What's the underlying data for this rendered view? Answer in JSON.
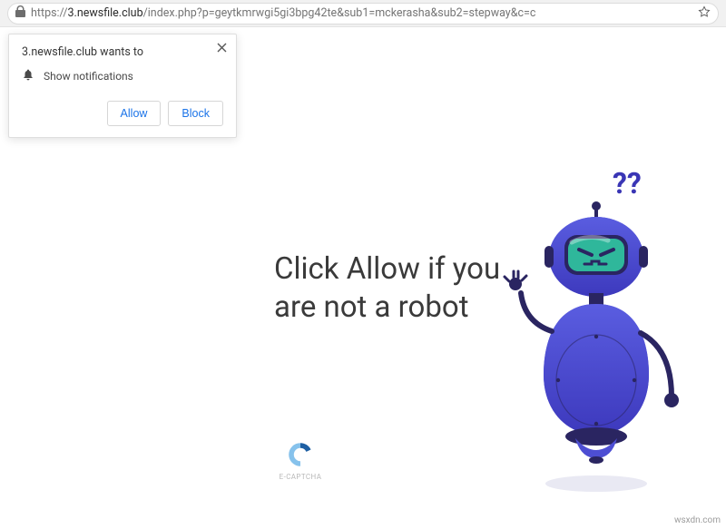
{
  "address_bar": {
    "scheme": "https://",
    "host": "3.newsfile.club",
    "path": "/index.php?p=geytkmrwgi5gi3bpg42te&sub1=mckerasha&sub2=stepway&c=c"
  },
  "notification": {
    "title": "3.newsfile.club wants to",
    "permission_text": "Show notifications",
    "allow_label": "Allow",
    "block_label": "Block"
  },
  "page": {
    "headline": "Click Allow if you are not a robot",
    "captcha_label": "E-CAPTCHA",
    "question_marks": "??"
  },
  "watermark": "wsxdn.com",
  "colors": {
    "accent": "#1a73e8",
    "robot_body": "#4d4ed3",
    "robot_body_dark": "#3a36b5",
    "robot_face": "#2fb79b",
    "captcha_light": "#86c2ec",
    "captcha_dark": "#1e5fa3"
  }
}
